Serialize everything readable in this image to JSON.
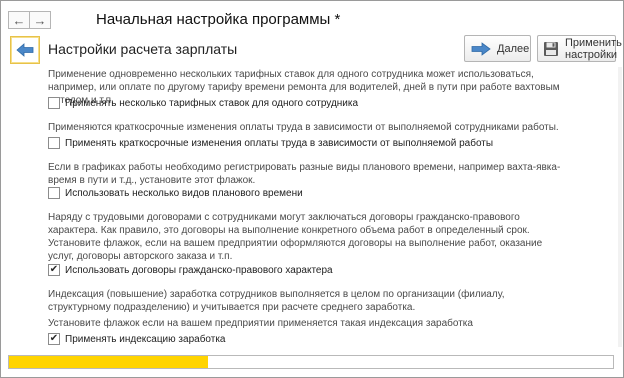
{
  "window": {
    "title": "Начальная настройка программы *",
    "nav_back_icon": "arrow-left-icon",
    "nav_forward_icon": "arrow-right-icon"
  },
  "header": {
    "title": "Настройки расчета зарплаты",
    "back_icon": "back-arrow-icon",
    "next_label": "Далее",
    "next_icon": "arrow-right-icon",
    "apply_label_line1": "Применить",
    "apply_label_line2": "настройки",
    "apply_icon": "floppy-disk-icon"
  },
  "sections": [
    {
      "description": "Применение одновременно нескольких тарифных ставок для одного сотрудника может использоваться, например, или оплате по другому тарифу времени ремонта для водителей, дней в пути при работе вахтовым методом и т.п.",
      "checkbox_label": "Применять несколько тарифных ставок для одного сотрудника",
      "checked": false
    },
    {
      "description": "Применяются краткосрочные изменения оплаты труда в зависимости от выполняемой сотрудниками работы.",
      "checkbox_label": "Применять краткосрочные изменения оплаты труда в зависимости от выполняемой работы",
      "checked": false
    },
    {
      "description": "Если в графиках работы необходимо регистрировать разные виды планового времени, например вахта-явка-время в пути и т.д., установите этот флажок.",
      "checkbox_label": "Использовать несколько видов планового времени",
      "checked": false
    },
    {
      "description": "Наряду с трудовыми договорами с сотрудниками могут заключаться договоры гражданско-правового характера. Как правило, это договоры на выполнение конкретного объема работ в определенный срок.",
      "description2": "Установите флажок, если на вашем предприятии оформляются договоры на выполнение работ, оказание услуг, договоры авторского заказа и т.п.",
      "checkbox_label": "Использовать договоры гражданско-правового характера",
      "checked": true
    },
    {
      "description": "Индексация (повышение) заработка сотрудников выполняется в целом по организации (филиалу, структурному подразделению) и учитывается при расчете среднего заработка.",
      "description2": "Установите флажок если на вашем предприятии применяется такая индексация заработка",
      "checkbox_label": "Применять индексацию заработка",
      "checked": true
    }
  ],
  "check_mark": "✔",
  "progress": {
    "fraction": 0.33,
    "color": "#ffd400"
  }
}
